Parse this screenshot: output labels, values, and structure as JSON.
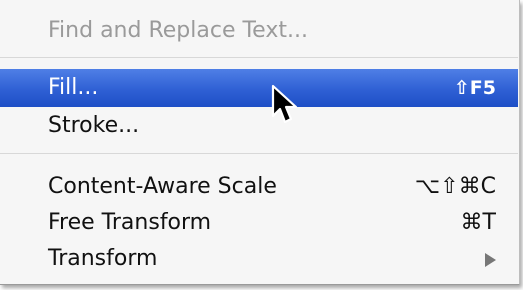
{
  "menu": {
    "items": [
      {
        "label": "Find and Replace Text...",
        "shortcut": "",
        "state": "disabled"
      },
      {
        "label": "Fill...",
        "shortcut": "⇧F5",
        "state": "highlighted"
      },
      {
        "label": "Stroke...",
        "shortcut": "",
        "state": "normal"
      },
      {
        "label": "Content-Aware Scale",
        "shortcut": "⌥⇧⌘C",
        "state": "normal"
      },
      {
        "label": "Free Transform",
        "shortcut": "⌘T",
        "state": "normal"
      },
      {
        "label": "Transform",
        "shortcut": "",
        "state": "normal",
        "submenu": true
      }
    ]
  },
  "colors": {
    "highlight": "#2f60d4",
    "menu_background": "#f6f6f6",
    "disabled_text": "#9a9a9a"
  },
  "icons": {
    "cursor": "arrow-cursor-icon",
    "submenu": "submenu-arrow-icon"
  }
}
